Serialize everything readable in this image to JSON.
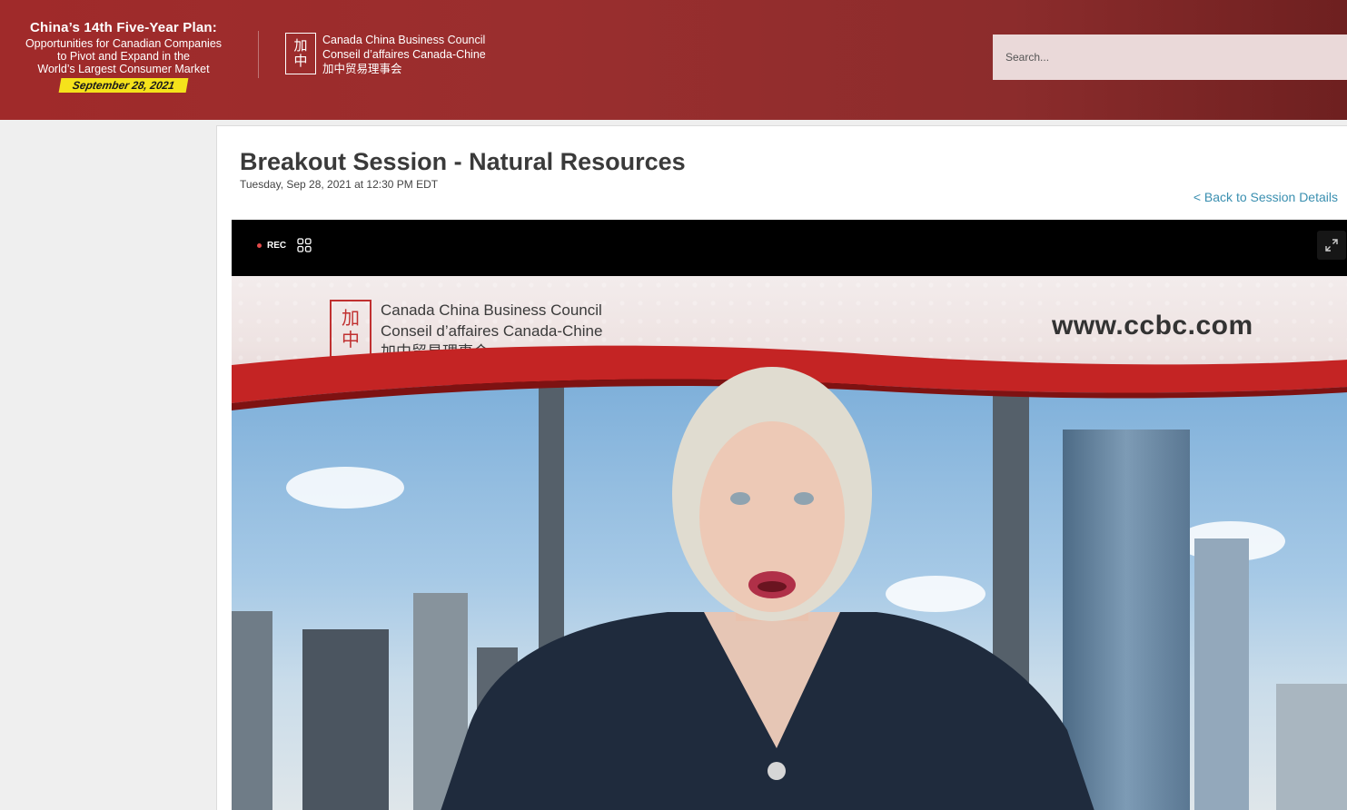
{
  "header": {
    "event_title": "China’s 14th Five-Year Plan:",
    "event_subtitle_lines": [
      "Opportunities for Canadian Companies",
      "to Pivot and Expand in the",
      "World’s Largest Consumer Market"
    ],
    "event_date": "September 28, 2021",
    "org_mark": [
      "加",
      "中"
    ],
    "org_name_lines": [
      "Canada China Business Council",
      "Conseil d’affaires Canada-Chine",
      "加中贸易理事会"
    ],
    "search_placeholder": "Search..."
  },
  "session": {
    "title": "Breakout Session - Natural Resources",
    "datetime": "Tuesday, Sep 28, 2021 at 12:30 PM EDT",
    "back_link": "< Back to Session Details"
  },
  "player": {
    "rec_label": "REC",
    "video_banner": {
      "org_name_lines": [
        "Canada China Business Council",
        "Conseil d’affaires Canada-Chine",
        "加中贸易理事会"
      ],
      "url": "www.ccbc.com"
    }
  },
  "colors": {
    "header_red": "#9a2e2e",
    "date_badge_yellow": "#f5e21b",
    "link_blue": "#3a8fb0",
    "rec_red": "#e24a4a"
  },
  "icons": {
    "grid": "grid-view-icon",
    "expand": "fullscreen-expand-icon"
  }
}
